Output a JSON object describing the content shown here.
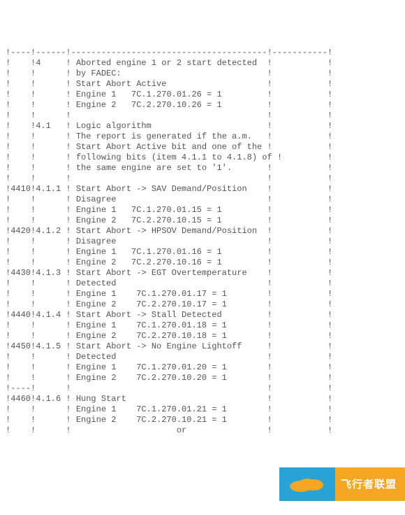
{
  "lines": [
    "!----!------!---------------------------------------!-----------!",
    "!    !4     ! Aborted engine 1 or 2 start detected  !           !",
    "!    !      ! by FADEC:                             !           !",
    "!    !      ! Start Abort Active                    !           !",
    "!    !      ! Engine 1   7C.1.270.01.26 = 1         !           !",
    "!    !      ! Engine 2   7C.2.270.10.26 = 1         !           !",
    "!    !      !                                       !           !",
    "!    !4.1   ! Logic algorithm                       !           !",
    "!    !      ! The report is generated if the a.m.   !           !",
    "!    !      ! Start Abort Active bit and one of the !           !",
    "!    !      ! following bits (item 4.1.1 to 4.1.8) of !         !",
    "!    !      ! the same engine are set to '1'.       !           !",
    "!    !      !                                       !           !",
    "!4410!4.1.1 ! Start Abort -> SAV Demand/Position    !           !",
    "!    !      ! Disagree                              !           !",
    "!    !      ! Engine 1   7C.1.270.01.15 = 1         !           !",
    "!    !      ! Engine 2   7C.2.270.10.15 = 1         !           !",
    "!4420!4.1.2 ! Start Abort -> HPSOV Demand/Position  !           !",
    "!    !      ! Disagree                              !           !",
    "!    !      ! Engine 1   7C.1.270.01.16 = 1         !           !",
    "!    !      ! Engine 2   7C.2.270.10.16 = 1         !           !",
    "!4430!4.1.3 ! Start Abort -> EGT Overtemperature    !           !",
    "!    !      ! Detected                              !           !",
    "!    !      ! Engine 1    7C.1.270.01.17 = 1        !           !",
    "!    !      ! Engine 2    7C.2.270.10.17 = 1        !           !",
    "!4440!4.1.4 ! Start Abort -> Stall Detected         !           !",
    "!    !      ! Engine 1    7C.1.270.01.18 = 1        !           !",
    "!    !      ! Engine 2    7C.2.270.10.18 = 1        !           !",
    "!4450!4.1.5 ! Start Abort -> No Engine Lightoff     !           !",
    "!    !      ! Detected                              !           !",
    "!    !      ! Engine 1    7C.1.270.01.20 = 1        !           !",
    "!    !      ! Engine 2    7C.2.270.10.20 = 1        !           !",
    "!----!      !                                       !           !",
    "!4460!4.1.6 ! Hung Start                            !           !",
    "!    !      ! Engine 1    7C.1.270.01.21 = 1        !           !",
    "!    !      ! Engine 2    7C.2.270.10.21 = 1        !           !",
    "!    !      !                     or                !           !"
  ],
  "banner": {
    "text": "飞行者联盟"
  }
}
